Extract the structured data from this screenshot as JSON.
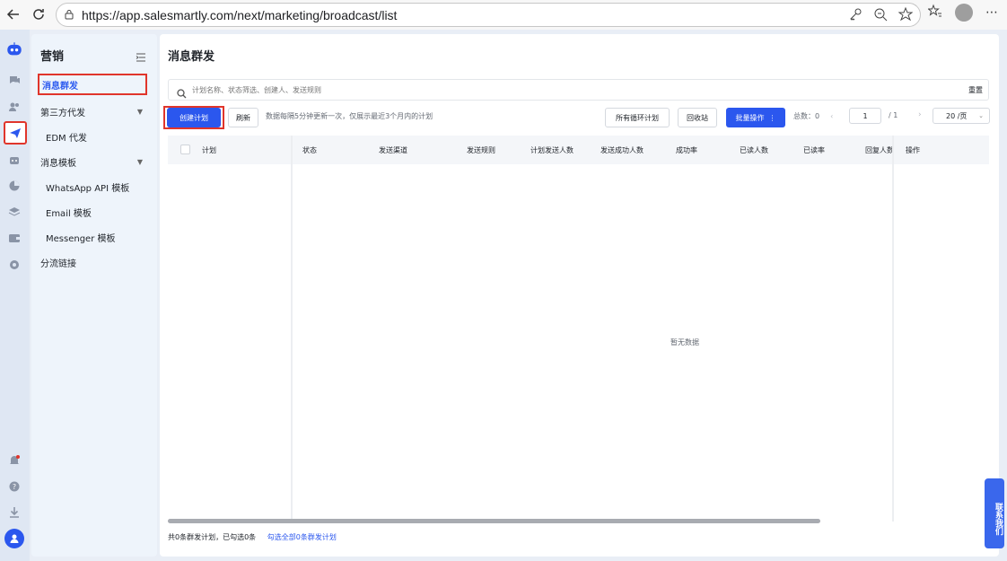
{
  "browser": {
    "url": "https://app.salesmartly.com/next/marketing/broadcast/list"
  },
  "sidebar": {
    "title": "营销",
    "items": [
      {
        "label": "消息群发",
        "active": true
      },
      {
        "label": "第三方代发"
      },
      {
        "label": "EDM 代发"
      },
      {
        "label": "消息模板"
      },
      {
        "label": "WhatsApp API 模板"
      },
      {
        "label": "Email 模板"
      },
      {
        "label": "Messenger 模板"
      },
      {
        "label": "分流链接"
      }
    ]
  },
  "main": {
    "title": "消息群发",
    "search_placeholder": "计划名称、状态筛选、创建人、发送规则",
    "reset_label": "重置",
    "create_label": "创建计划",
    "refresh_label": "刷新",
    "notice": "数据每隔5分钟更新一次，仅展示最近3个月内的计划",
    "loop_plans_label": "所有循环计划",
    "recycle_label": "回收站",
    "batch_label": "批量操作",
    "total_label": "总数：0",
    "page_current": "1",
    "page_total": "/ 1",
    "page_size": "20 /页",
    "columns": [
      "计划",
      "状态",
      "发送渠道",
      "发送规则",
      "计划发送人数",
      "发送成功人数",
      "成功率",
      "已读人数",
      "已读率",
      "回复人数",
      "操作"
    ],
    "empty_text": "暂无数据",
    "footer_text": "共0条群发计划，已勾选0条",
    "footer_link": "勾选全部0条群发计划"
  },
  "contact_label": "联系我们",
  "colors": {
    "accent": "#2b57ee",
    "highlight": "#e0352b",
    "sidebar_bg": "#eef4fb"
  }
}
